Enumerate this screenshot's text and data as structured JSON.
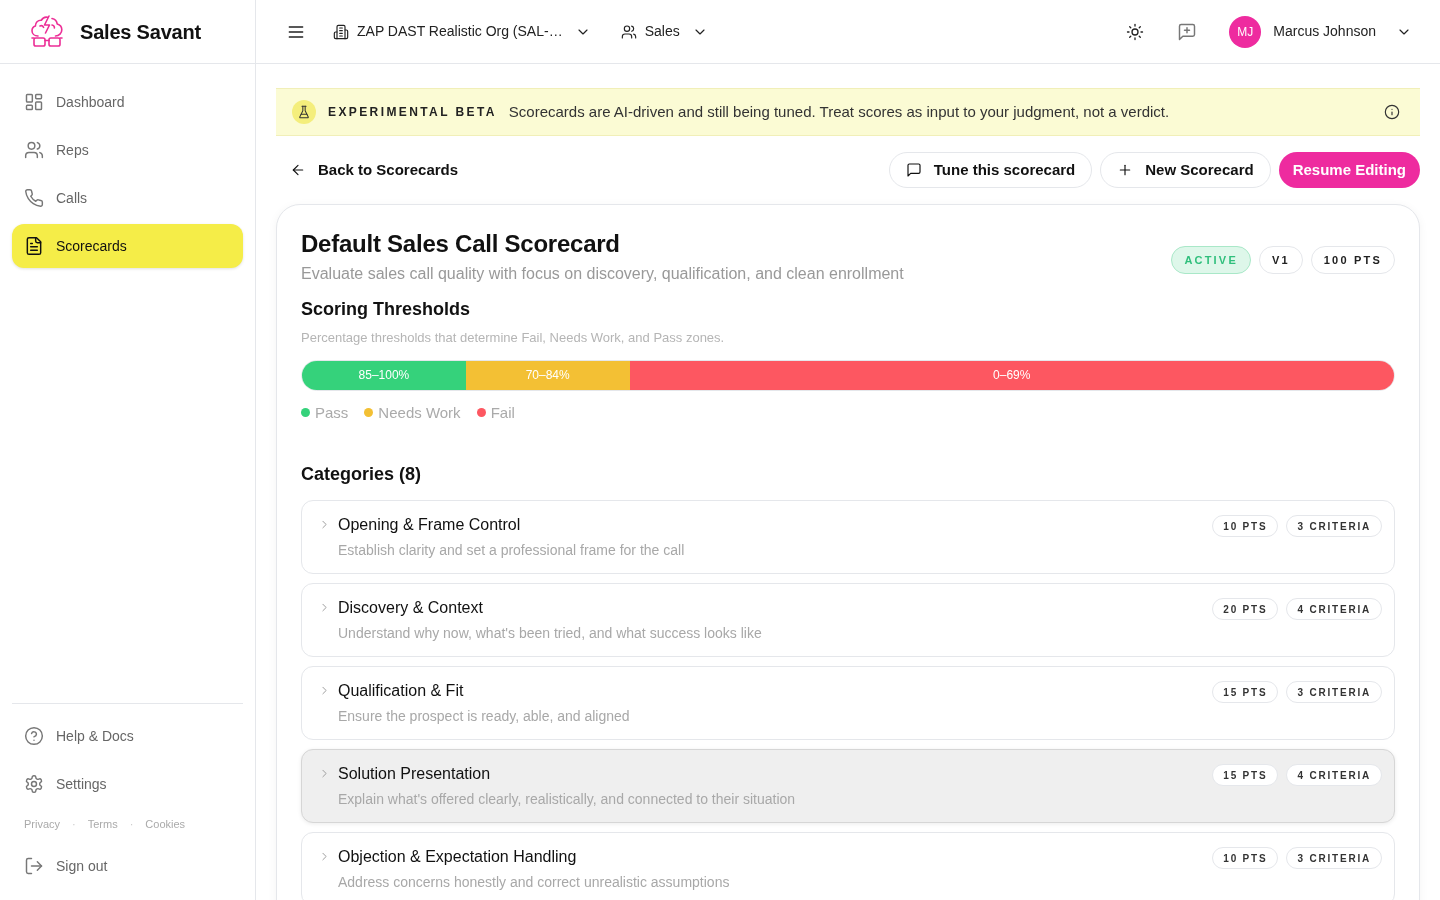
{
  "app": {
    "name": "Sales Savant"
  },
  "sidebar": {
    "items": [
      {
        "label": "Dashboard",
        "selected": false
      },
      {
        "label": "Reps",
        "selected": false
      },
      {
        "label": "Calls",
        "selected": false
      },
      {
        "label": "Scorecards",
        "selected": true
      }
    ],
    "bottom_items": [
      {
        "label": "Help & Docs"
      },
      {
        "label": "Settings"
      }
    ],
    "footer": [
      {
        "kind": "link",
        "label": "Privacy"
      },
      {
        "kind": "separator",
        "label": "·"
      },
      {
        "kind": "link",
        "label": "Terms"
      },
      {
        "kind": "separator",
        "label": "·"
      },
      {
        "kind": "link",
        "label": "Cookies"
      }
    ],
    "sign_out": "Sign out"
  },
  "top_bar": {
    "org": "ZAP DAST Realistic Org (SAL-…",
    "team": "Sales",
    "user": {
      "initials": "MJ",
      "name": "Marcus Johnson"
    }
  },
  "banner": {
    "tag": "EXPERIMENTAL BETA",
    "message": "Scorecards are AI-driven and still being tuned. Treat scores as input to your judgment, not a verdict."
  },
  "actions": {
    "back": "Back to Scorecards",
    "buttons": [
      {
        "label": "Tune this scorecard",
        "kind": "outline"
      },
      {
        "label": "New Scorecard",
        "kind": "outline"
      },
      {
        "label": "Resume Editing",
        "kind": "primary"
      }
    ]
  },
  "scorecard": {
    "title": "Default Sales Call Scorecard",
    "description": "Evaluate sales call quality with focus on discovery, qualification, and clean enrollment",
    "badges": [
      {
        "label": "ACTIVE",
        "kind": "status"
      },
      {
        "label": "V1",
        "kind": "plain"
      },
      {
        "label": "100 PTS",
        "kind": "plain"
      }
    ]
  },
  "thresholds": {
    "title": "Scoring Thresholds",
    "description": "Percentage thresholds that determine Fail, Needs Work, and Pass zones.",
    "segments": [
      {
        "label": "85–100%",
        "level": 0.15,
        "color": "#35d27b"
      },
      {
        "label": "70–84%",
        "level": 0.15,
        "color": "#f3c034"
      },
      {
        "label": "0–69%",
        "level": 0.7,
        "color": "#fd5761"
      }
    ],
    "legend": [
      {
        "label": "Pass",
        "color": "#35d27b"
      },
      {
        "label": "Needs Work",
        "color": "#f3c034"
      },
      {
        "label": "Fail",
        "color": "#fd5761"
      }
    ]
  },
  "categories": {
    "title": "Categories (8)",
    "items": [
      {
        "title": "Opening & Frame Control",
        "description": "Establish clarity and set a professional frame for the call",
        "points": "10 PTS",
        "criteria": "3 CRITERIA",
        "expanded": false,
        "hovered": false
      },
      {
        "title": "Discovery & Context",
        "description": "Understand why now, what's been tried, and what success looks like",
        "points": "20 PTS",
        "criteria": "4 CRITERIA",
        "expanded": false,
        "hovered": false
      },
      {
        "title": "Qualification & Fit",
        "description": "Ensure the prospect is ready, able, and aligned",
        "points": "15 PTS",
        "criteria": "3 CRITERIA",
        "expanded": false,
        "hovered": false
      },
      {
        "title": "Solution Presentation",
        "description": "Explain what's offered clearly, realistically, and connected to their situation",
        "points": "15 PTS",
        "criteria": "4 CRITERIA",
        "expanded": false,
        "hovered": true
      },
      {
        "title": "Objection & Expectation Handling",
        "description": "Address concerns honestly and correct unrealistic assumptions",
        "points": "10 PTS",
        "criteria": "3 CRITERIA",
        "expanded": false,
        "hovered": false
      }
    ]
  }
}
